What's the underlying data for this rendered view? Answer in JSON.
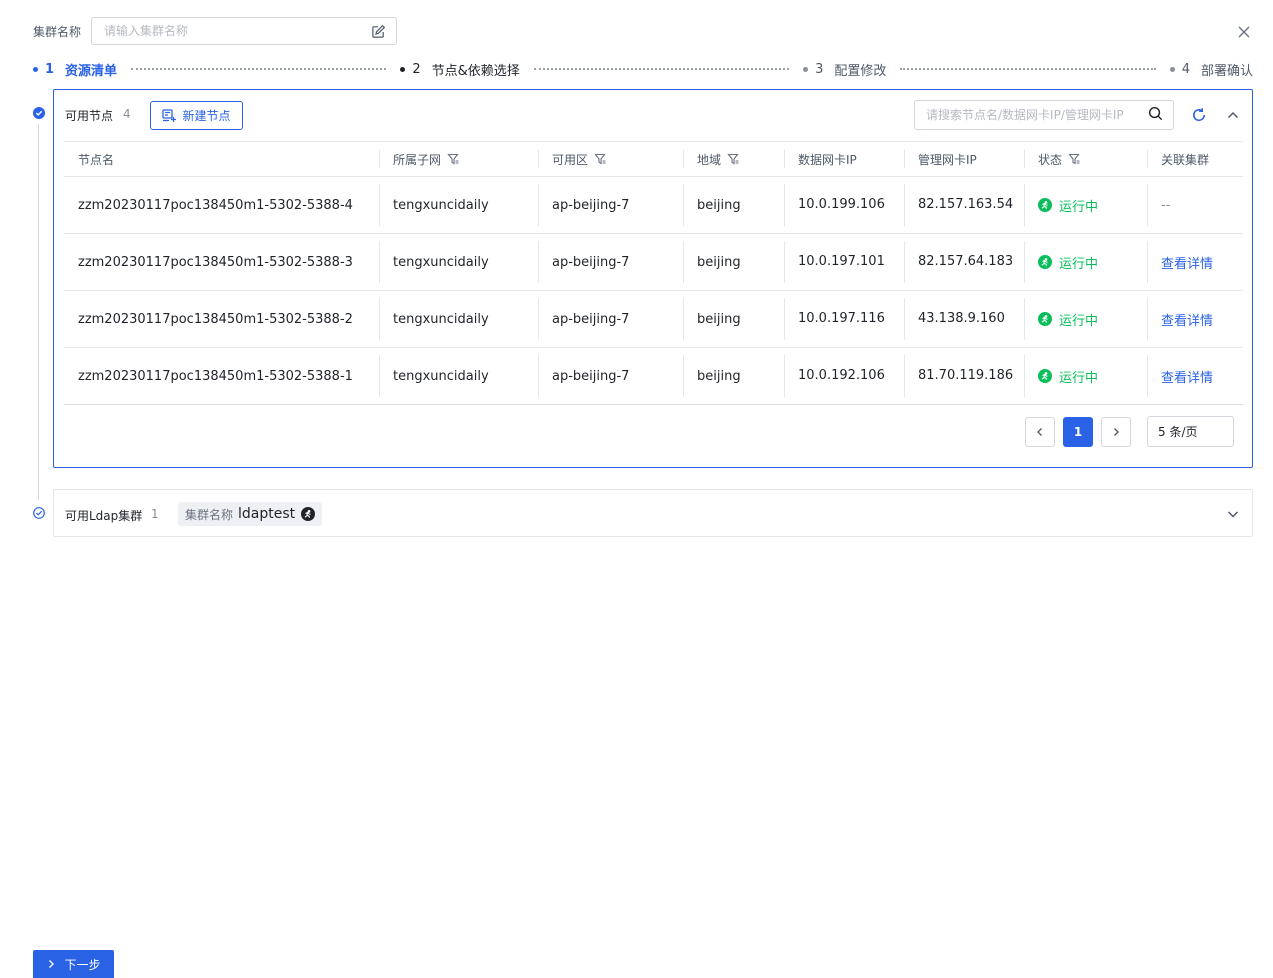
{
  "header": {
    "cluster_name_label": "集群名称",
    "cluster_name_placeholder": "请输入集群名称",
    "cluster_name_value": ""
  },
  "steps": [
    {
      "num": "1",
      "label": "资源清单",
      "state": "active"
    },
    {
      "num": "2",
      "label": "节点&依赖选择",
      "state": "current"
    },
    {
      "num": "3",
      "label": "配置修改",
      "state": "todo"
    },
    {
      "num": "4",
      "label": "部署确认",
      "state": "todo"
    }
  ],
  "nodes_panel": {
    "title": "可用节点",
    "count": "4",
    "new_button": "新建节点",
    "search_placeholder": "请搜索节点名/数据网卡IP/管理网卡IP",
    "columns": [
      "节点名",
      "所属子网",
      "可用区",
      "地域",
      "数据网卡IP",
      "管理网卡IP",
      "状态",
      "关联集群"
    ],
    "rows": [
      {
        "name": "zzm20230117poc138450m1-5302-5388-4",
        "subnet": "tengxuncidaily",
        "zone": "ap-beijing-7",
        "region": "beijing",
        "data_ip": "10.0.199.106",
        "mgmt_ip": "82.157.163.54",
        "status": "运行中",
        "cluster": "--"
      },
      {
        "name": "zzm20230117poc138450m1-5302-5388-3",
        "subnet": "tengxuncidaily",
        "zone": "ap-beijing-7",
        "region": "beijing",
        "data_ip": "10.0.197.101",
        "mgmt_ip": "82.157.64.183",
        "status": "运行中",
        "cluster": "查看详情"
      },
      {
        "name": "zzm20230117poc138450m1-5302-5388-2",
        "subnet": "tengxuncidaily",
        "zone": "ap-beijing-7",
        "region": "beijing",
        "data_ip": "10.0.197.116",
        "mgmt_ip": "43.138.9.160",
        "status": "运行中",
        "cluster": "查看详情"
      },
      {
        "name": "zzm20230117poc138450m1-5302-5388-1",
        "subnet": "tengxuncidaily",
        "zone": "ap-beijing-7",
        "region": "beijing",
        "data_ip": "10.0.192.106",
        "mgmt_ip": "81.70.119.186",
        "status": "运行中",
        "cluster": "查看详情"
      }
    ],
    "pagination": {
      "current_page": "1",
      "page_size": "5 条/页"
    }
  },
  "ldap_panel": {
    "title": "可用Ldap集群",
    "count": "1",
    "tag_key": "集群名称",
    "tag_value": "ldaptest"
  },
  "footer": {
    "next_button": "下一步"
  },
  "colors": {
    "primary": "#2a62e6",
    "success": "#0abf5b",
    "border": "#e5e7eb"
  }
}
